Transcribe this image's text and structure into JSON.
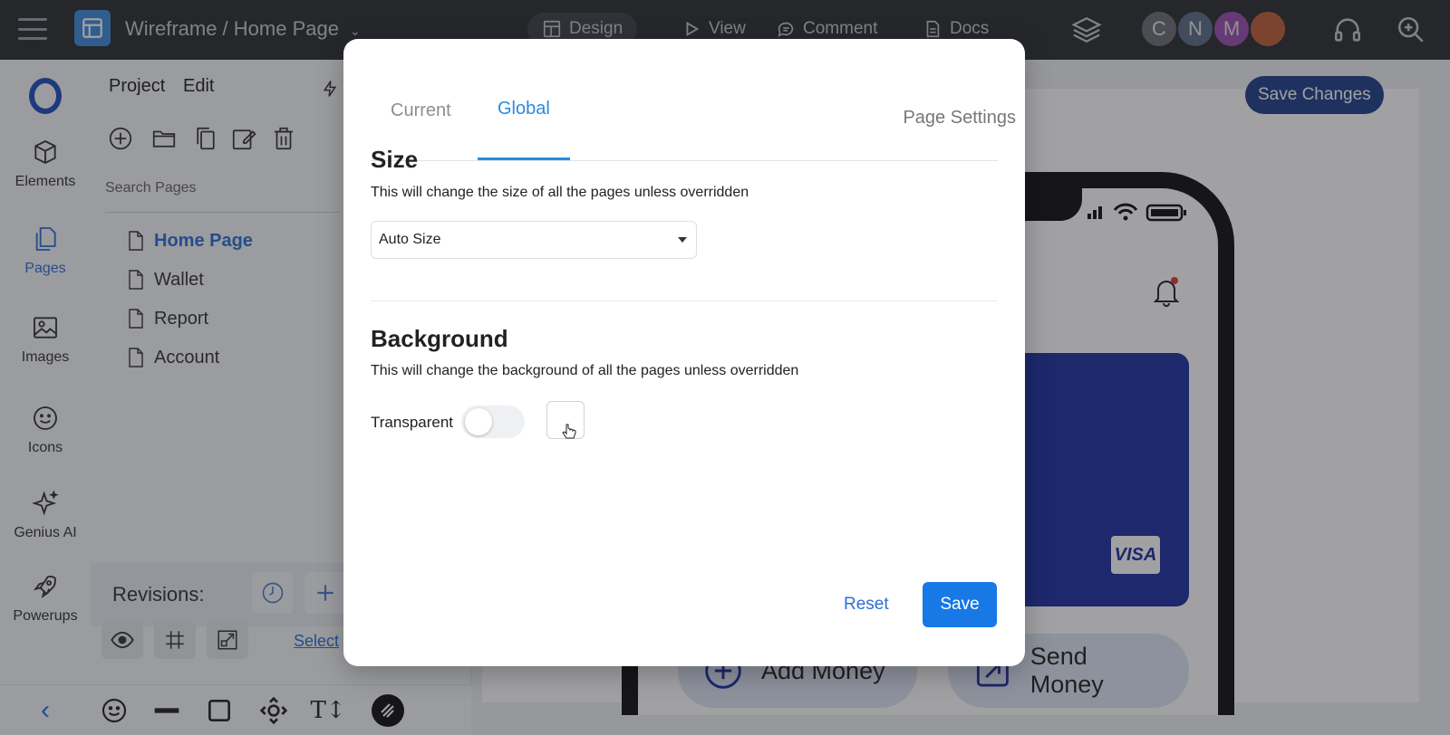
{
  "topbar": {
    "title": "Wireframe / Home Page",
    "modes": [
      {
        "label": "Design",
        "active": true,
        "icon": "layout-icon"
      },
      {
        "label": "View",
        "active": false,
        "icon": "play-icon"
      },
      {
        "label": "Comment",
        "active": false,
        "icon": "comment-icon"
      },
      {
        "label": "Docs",
        "active": false,
        "icon": "document-icon"
      }
    ],
    "avatars": [
      {
        "initial": "C",
        "color": "#6b6f75"
      },
      {
        "initial": "N",
        "color": "#5b6d86"
      },
      {
        "initial": "M",
        "color": "#9a4fb0"
      },
      {
        "initial": "",
        "color": "#c0603a"
      }
    ]
  },
  "rail": {
    "items": [
      {
        "label": "Elements",
        "icon": "cube-icon"
      },
      {
        "label": "Pages",
        "icon": "pages-icon",
        "active": true
      },
      {
        "label": "Images",
        "icon": "image-icon"
      },
      {
        "label": "Icons",
        "icon": "smiley-icon"
      },
      {
        "label": "Genius AI",
        "icon": "sparkle-icon"
      },
      {
        "label": "Powerups",
        "icon": "rocket-icon"
      }
    ]
  },
  "panel": {
    "menu": [
      "Project",
      "Edit"
    ],
    "search_placeholder": "Search Pages",
    "pages": [
      {
        "label": "Home Page",
        "active": true
      },
      {
        "label": "Wallet"
      },
      {
        "label": "Report"
      },
      {
        "label": "Account"
      }
    ],
    "revisions_label": "Revisions:",
    "select_link": "Select"
  },
  "canvas": {
    "save_changes": "Save Changes",
    "card_brand": "VISA",
    "actions": [
      "Add Money",
      "Send Money"
    ]
  },
  "modal": {
    "tabs": [
      {
        "label": "Current",
        "active": false
      },
      {
        "label": "Global",
        "active": true
      }
    ],
    "header_right": "Page Settings",
    "size": {
      "title": "Size",
      "description": "This will change the size of all the pages unless overridden",
      "selected": "Auto Size"
    },
    "background": {
      "title": "Background",
      "description": "This will change the background of all the pages unless overridden",
      "transparent_label": "Transparent",
      "transparent_on": false,
      "swatch_color": "#ffffff"
    },
    "reset_label": "Reset",
    "save_label": "Save"
  }
}
